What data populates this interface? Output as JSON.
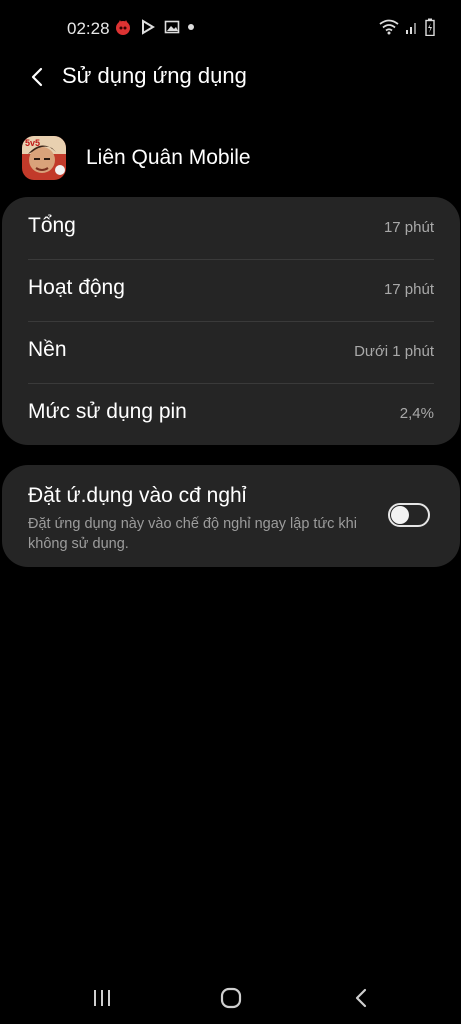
{
  "status_bar": {
    "time": "02:28",
    "icons": [
      "game-notification-icon",
      "play-store-icon",
      "gallery-icon",
      "dot-icon",
      "wifi-icon",
      "signal-icon",
      "battery-icon"
    ]
  },
  "header": {
    "title": "Sử dụng ứng dụng"
  },
  "app": {
    "name": "Liên Quân Mobile",
    "icon": "lien-quan-app-icon"
  },
  "usage": {
    "rows": [
      {
        "label": "Tổng",
        "value": "17 phút"
      },
      {
        "label": "Hoạt động",
        "value": "17 phút"
      },
      {
        "label": "Nền",
        "value": "Dưới 1 phút"
      },
      {
        "label": "Mức sử dụng pin",
        "value": "2,4%"
      }
    ]
  },
  "sleep_setting": {
    "title": "Đặt ứ.dụng vào cđ nghỉ",
    "description": "Đặt ứng dụng này vào chế độ nghỉ ngay lập tức khi không sử dụng.",
    "enabled": false
  },
  "nav_bar": {
    "buttons": [
      "recents-icon",
      "home-icon",
      "back-icon"
    ]
  },
  "colors": {
    "background": "#000000",
    "card": "#252525",
    "secondary_text": "#a9a9a9"
  }
}
